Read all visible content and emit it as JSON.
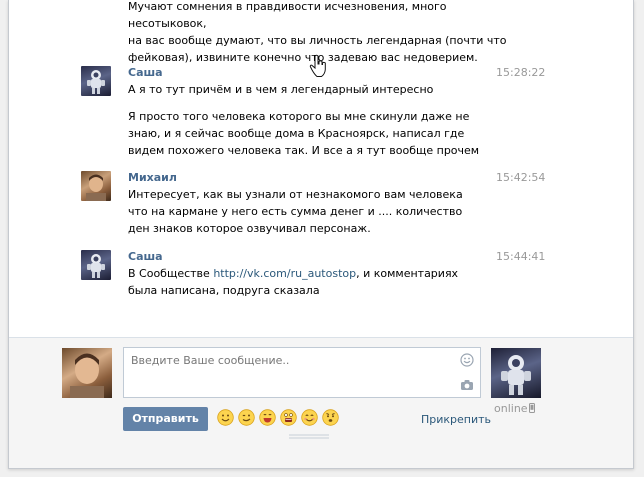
{
  "messages": [
    {
      "name": "",
      "time": "",
      "avatar": "",
      "paragraphs": [
        "Мучают сомнения в правдивости исчезновения, много несотыковок,",
        "на вас вообще думают, что вы личность легендарная (почти что",
        "фейковая), извините конечно что задеваю вас недоверием."
      ]
    },
    {
      "name": "Саша",
      "time": "15:28:22",
      "avatar": "astronaut",
      "paragraphs": [
        "А я то тут причём и в чем я легендарный интересно",
        "Я просто того человека которого вы мне скинули даже не знаю, и я сейчас вообще дома в Красноярск, написал где видем похожего человека так. И все а я тут вообще прочем"
      ]
    },
    {
      "name": "Михаил",
      "time": "15:42:54",
      "avatar": "photo",
      "paragraphs": [
        "Интересует, как вы узнали от незнакомого вам человека что на кармане у него есть сумма денег и .... количество ден знаков которое озвучивал персонаж."
      ]
    },
    {
      "name": "Саша",
      "time": "15:44:41",
      "avatar": "astronaut",
      "text_before_link": "В Сообществе ",
      "link": "http://vk.com/ru_autostop",
      "text_after_link": ", и комментариях была написана, подруга сказала"
    }
  ],
  "composer": {
    "placeholder": "Введите Ваше сообщение..",
    "send_label": "Отправить",
    "attach_label": "Прикрепить",
    "peer_status": "online",
    "emojis": [
      "smile",
      "wink",
      "laugh",
      "scared",
      "happy",
      "surprised"
    ]
  },
  "colors": {
    "name": "#45688e",
    "link": "#2b587a",
    "send_button": "#6383a8",
    "time": "#999999"
  }
}
